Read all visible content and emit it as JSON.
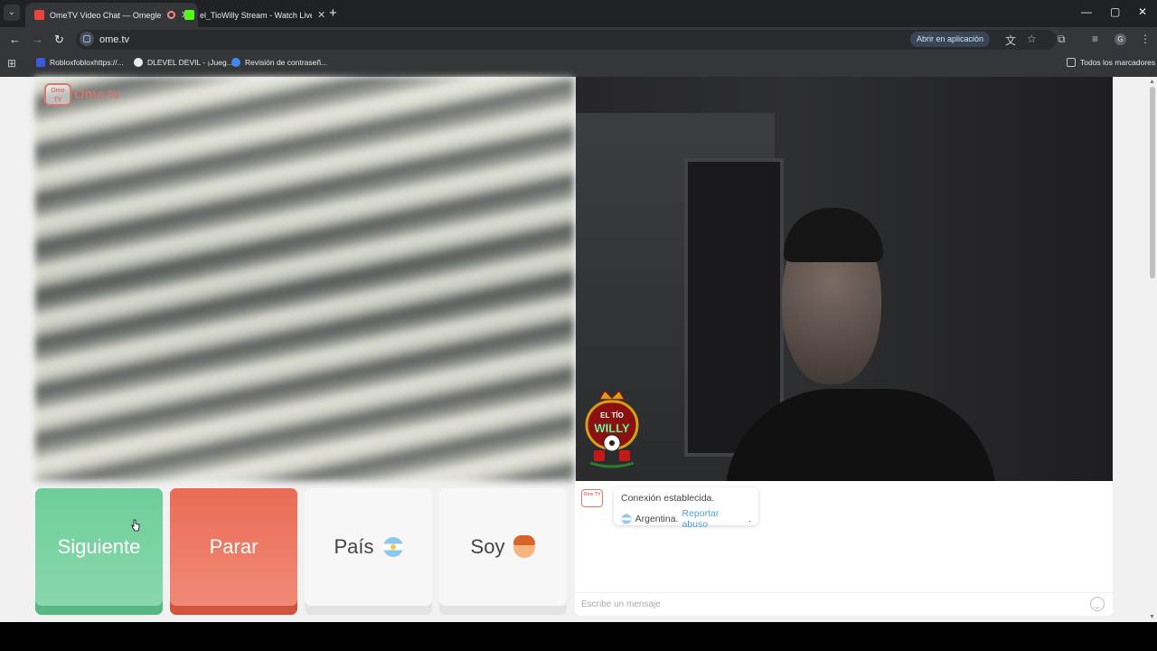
{
  "browser": {
    "tabs": [
      {
        "title": "OmeTV Video Chat — Omegle",
        "active": true,
        "recording": true,
        "favicon_color": "#e8453c"
      },
      {
        "title": "el_TioWilly Stream - Watch Live on",
        "active": false,
        "recording": false,
        "favicon_color": "#53fc18"
      }
    ],
    "url": "ome.tv",
    "open_in_app_label": "Abrir en aplicación",
    "profile_initial": "G",
    "bookmarks": [
      {
        "label": "Robloxfobloxhttps://...",
        "color": "#3b5bdb"
      },
      {
        "label": "DLEVEL DEVIL - ¡Jueg...",
        "color": "#e8eaed"
      },
      {
        "label": "Revisión de contraseñ...",
        "color": "#4285f4"
      }
    ],
    "all_bookmarks_label": "Todos los marcadores"
  },
  "site": {
    "logo_text": "Ome.tv",
    "logo_tv_text": "Ome TV",
    "buttons": {
      "next": "Siguiente",
      "stop": "Parar",
      "country": "País",
      "gender": "Soy"
    },
    "chat": {
      "status": "Conexión establecida.",
      "country": "Argentina.",
      "report": "Reportar abuso",
      "report_suffix": ".",
      "input_placeholder": "Escribe un mensaje"
    },
    "stream_logo_text": "EL TÍO WILLY"
  },
  "colors": {
    "next_button": "#6ecd9a",
    "stop_button": "#ea6c55",
    "brand": "#d9776d",
    "link": "#4a9fd8"
  }
}
